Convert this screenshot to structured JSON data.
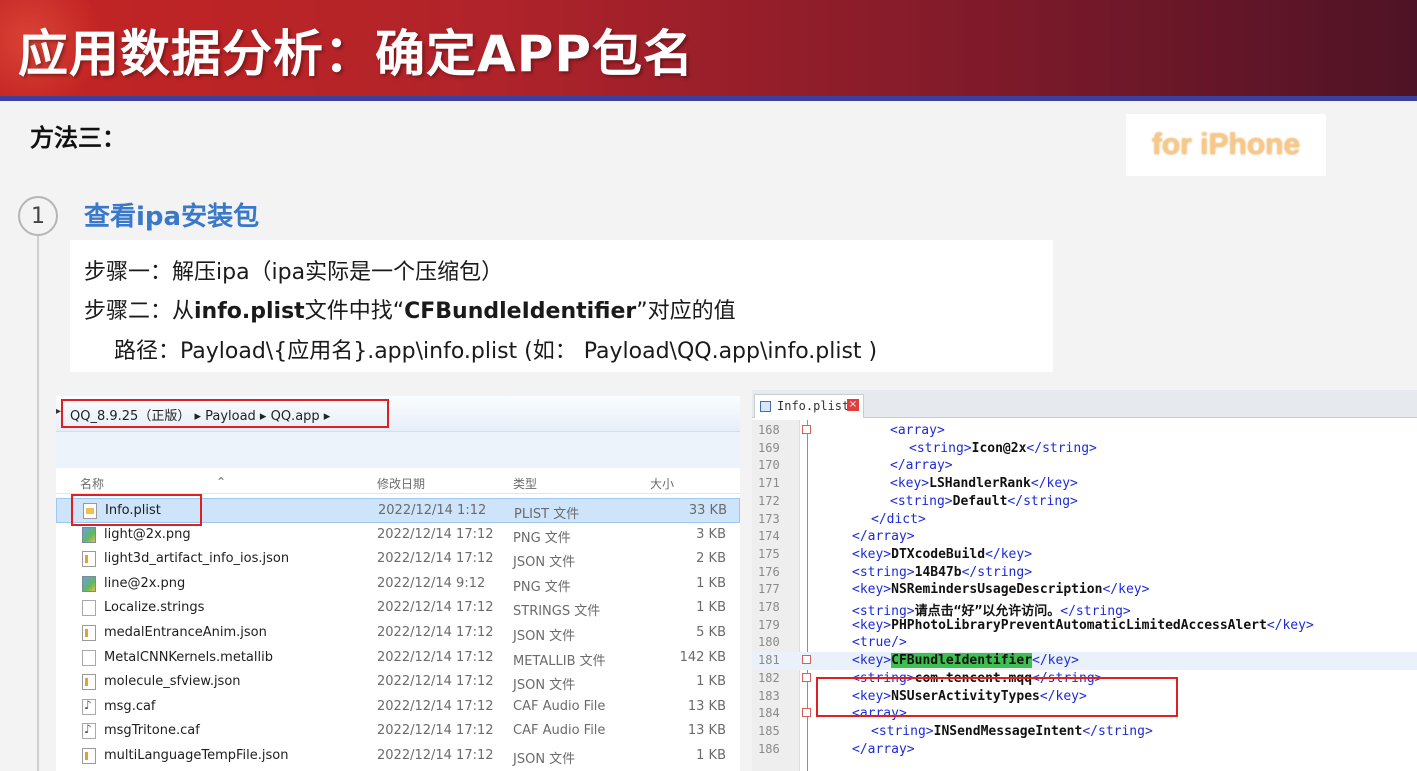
{
  "slide": {
    "title": "应用数据分析：确定APP包名",
    "method": "方法三：",
    "badge": "for iPhone",
    "step_number": "1",
    "section_title": "查看ipa安装包",
    "step1": "步骤一：解压ipa（ipa实际是一个压缩包）",
    "step2_prefix": "步骤二：从",
    "step2_bold1": "info.plist",
    "step2_mid": "文件中找“",
    "step2_bold2": "CFBundleIdentifier",
    "step2_suffix": "”对应的值",
    "path_line": "路径：Payload\\{应用名}.app\\info.plist (如： Payload\\QQ.app\\info.plist )"
  },
  "explorer": {
    "address": "QQ_8.9.25（正版） ▸ Payload ▸ QQ.app ▸",
    "columns": {
      "name": "名称",
      "date": "修改日期",
      "type": "类型",
      "size": "大小"
    },
    "files": [
      {
        "name": "Info.plist",
        "date": "2022/12/14 1:12",
        "type": "PLIST 文件",
        "size": "33 KB",
        "icon": "plist-file-icon"
      },
      {
        "name": "light@2x.png",
        "date": "2022/12/14 17:12",
        "type": "PNG 文件",
        "size": "3 KB",
        "icon": "png-file-icon"
      },
      {
        "name": "light3d_artifact_info_ios.json",
        "date": "2022/12/14 17:12",
        "type": "JSON 文件",
        "size": "2 KB",
        "icon": "json-file-icon"
      },
      {
        "name": "line@2x.png",
        "date": "2022/12/14 9:12",
        "type": "PNG 文件",
        "size": "1 KB",
        "icon": "png-file-icon"
      },
      {
        "name": "Localize.strings",
        "date": "2022/12/14 17:12",
        "type": "STRINGS 文件",
        "size": "1 KB",
        "icon": "generic-file-icon"
      },
      {
        "name": "medalEntranceAnim.json",
        "date": "2022/12/14 17:12",
        "type": "JSON 文件",
        "size": "5 KB",
        "icon": "json-file-icon"
      },
      {
        "name": "MetalCNNKernels.metallib",
        "date": "2022/12/14 17:12",
        "type": "METALLIB 文件",
        "size": "142 KB",
        "icon": "generic-file-icon"
      },
      {
        "name": "molecule_sfview.json",
        "date": "2022/12/14 17:12",
        "type": "JSON 文件",
        "size": "1 KB",
        "icon": "json-file-icon"
      },
      {
        "name": "msg.caf",
        "date": "2022/12/14 17:12",
        "type": "CAF Audio File",
        "size": "13 KB",
        "icon": "audio-file-icon"
      },
      {
        "name": "msgTritone.caf",
        "date": "2022/12/14 17:12",
        "type": "CAF Audio File",
        "size": "13 KB",
        "icon": "audio-file-icon"
      },
      {
        "name": "multiLanguageTempFile.json",
        "date": "2022/12/14 17:12",
        "type": "JSON 文件",
        "size": "1 KB",
        "icon": "json-file-icon"
      }
    ]
  },
  "editor": {
    "tab_label": "Info.plist",
    "lines": [
      {
        "n": "168",
        "indent": 2,
        "parts": [
          [
            "t",
            "<array>"
          ]
        ]
      },
      {
        "n": "169",
        "indent": 3,
        "parts": [
          [
            "t",
            "<string>"
          ],
          [
            "x",
            "Icon@2x"
          ],
          [
            "t",
            "</string>"
          ]
        ]
      },
      {
        "n": "170",
        "indent": 2,
        "parts": [
          [
            "t",
            "</array>"
          ]
        ]
      },
      {
        "n": "171",
        "indent": 2,
        "parts": [
          [
            "t",
            "<key>"
          ],
          [
            "x",
            "LSHandlerRank"
          ],
          [
            "t",
            "</key>"
          ]
        ]
      },
      {
        "n": "172",
        "indent": 2,
        "parts": [
          [
            "t",
            "<string>"
          ],
          [
            "x",
            "Default"
          ],
          [
            "t",
            "</string>"
          ]
        ]
      },
      {
        "n": "173",
        "indent": 1,
        "parts": [
          [
            "t",
            "</dict>"
          ]
        ]
      },
      {
        "n": "174",
        "indent": 0,
        "parts": [
          [
            "t",
            "</array>"
          ]
        ]
      },
      {
        "n": "175",
        "indent": 0,
        "parts": [
          [
            "t",
            "<key>"
          ],
          [
            "x",
            "DTXcodeBuild"
          ],
          [
            "t",
            "</key>"
          ]
        ]
      },
      {
        "n": "176",
        "indent": 0,
        "parts": [
          [
            "t",
            "<string>"
          ],
          [
            "x",
            "14B47b"
          ],
          [
            "t",
            "</string>"
          ]
        ]
      },
      {
        "n": "177",
        "indent": 0,
        "parts": [
          [
            "t",
            "<key>"
          ],
          [
            "x",
            "NSRemindersUsageDescription"
          ],
          [
            "t",
            "</key>"
          ]
        ]
      },
      {
        "n": "178",
        "indent": 0,
        "parts": [
          [
            "t",
            "<string>"
          ],
          [
            "x",
            "请点击“好”以允许访问。"
          ],
          [
            "t",
            "</string>"
          ]
        ]
      },
      {
        "n": "179",
        "indent": 0,
        "parts": [
          [
            "t",
            "<key>"
          ],
          [
            "x",
            "PHPhotoLibraryPreventAutomaticLimitedAccessAlert"
          ],
          [
            "t",
            "</key>"
          ]
        ]
      },
      {
        "n": "180",
        "indent": 0,
        "parts": [
          [
            "t",
            "<true/>"
          ]
        ]
      },
      {
        "n": "181",
        "indent": 0,
        "parts": [
          [
            "t",
            "<key>"
          ],
          [
            "g",
            "CFBundleIdentifier"
          ],
          [
            "t",
            "</key>"
          ]
        ]
      },
      {
        "n": "182",
        "indent": 0,
        "parts": [
          [
            "t",
            "<string>"
          ],
          [
            "x",
            "com.tencent.mqq"
          ],
          [
            "t",
            "</string>"
          ]
        ]
      },
      {
        "n": "183",
        "indent": 0,
        "parts": [
          [
            "t",
            "<key>"
          ],
          [
            "x",
            "NSUserActivityTypes"
          ],
          [
            "t",
            "</key>"
          ]
        ]
      },
      {
        "n": "184",
        "indent": 0,
        "parts": [
          [
            "t",
            "<array>"
          ]
        ]
      },
      {
        "n": "185",
        "indent": 1,
        "parts": [
          [
            "t",
            "<string>"
          ],
          [
            "x",
            "INSendMessageIntent"
          ],
          [
            "t",
            "</string>"
          ]
        ]
      },
      {
        "n": "186",
        "indent": 0,
        "parts": [
          [
            "t",
            "</array>"
          ]
        ]
      }
    ]
  }
}
